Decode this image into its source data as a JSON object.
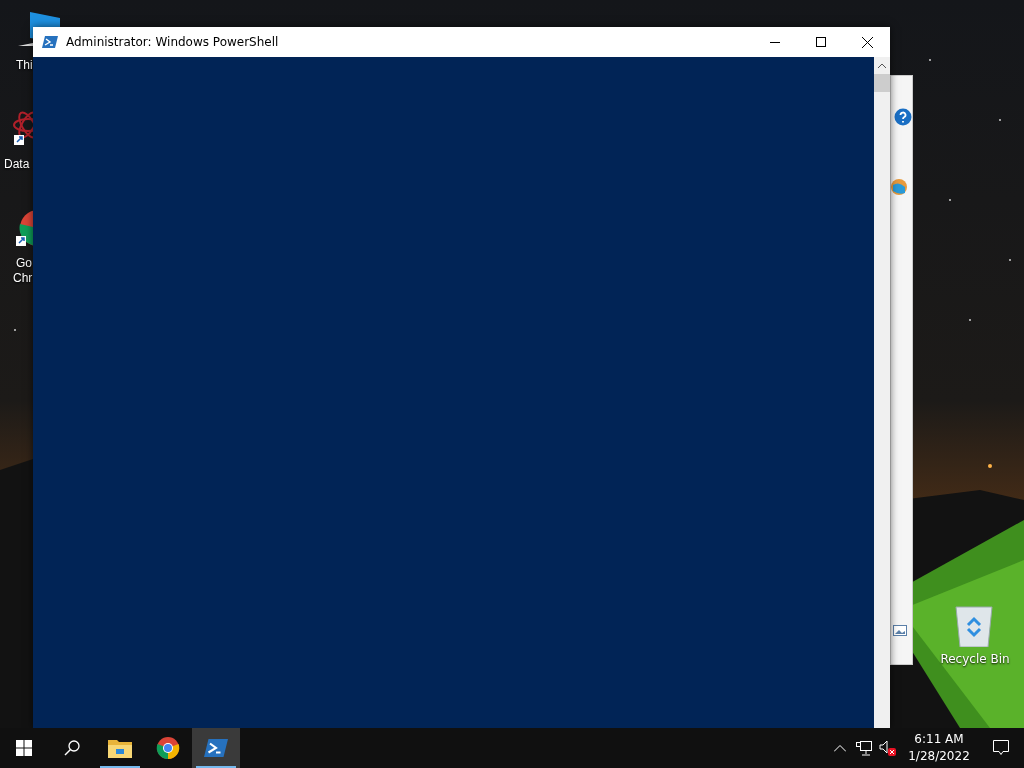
{
  "desktop": {
    "icons": [
      {
        "kind": "pc",
        "lines": [
          "Thi"
        ]
      },
      {
        "kind": "atom",
        "lines": [
          "Data"
        ]
      },
      {
        "kind": "chrome",
        "lines": [
          "Go",
          "Chr"
        ]
      }
    ],
    "recycle_bin": {
      "label": "Recycle Bin"
    }
  },
  "window": {
    "title": "Administrator: Windows PowerShell"
  },
  "taskbar": {
    "apps": [
      {
        "kind": "explorer",
        "running": true,
        "selected": false
      },
      {
        "kind": "chrome",
        "running": false,
        "selected": false
      },
      {
        "kind": "powershell",
        "running": true,
        "selected": true
      }
    ],
    "volume_muted": true,
    "clock": {
      "time": "6:11 AM",
      "date": "1/28/2022"
    }
  }
}
